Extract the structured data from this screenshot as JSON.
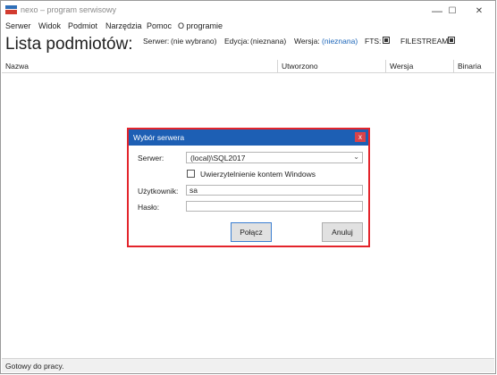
{
  "window": {
    "title": "nexo – program serwisowy",
    "minimize_glyph": "—",
    "maximize_glyph": "☐",
    "close_glyph": "✕"
  },
  "menu": [
    "Serwer",
    "Widok",
    "Podmiot",
    "Narzędzia",
    "Pomoc",
    "O programie"
  ],
  "page": {
    "title": "Lista podmiotów:",
    "server_label": "Serwer:",
    "server_value": "(nie wybrano)",
    "edition_label": "Edycja:",
    "edition_value": "(nieznana)",
    "version_label": "Wersja:",
    "version_value": "(nieznana)",
    "fts_label": "FTS:",
    "filestream_label": "FILESTREAM:"
  },
  "grid": {
    "columns": [
      "Nazwa",
      "Utworzono",
      "Wersja",
      "Binaria"
    ]
  },
  "status_bar": {
    "text": "Gotowy do pracy."
  },
  "dialog": {
    "title": "Wybór serwera",
    "close_glyph": "x",
    "server_label": "Serwer:",
    "server_value": "(local)\\SQL2017",
    "windows_auth_label": "Uwierzytelnienie kontem Windows",
    "user_label": "Użytkownik:",
    "user_value": "sa",
    "password_label": "Hasło:",
    "password_value": "",
    "connect_label": "Połącz",
    "cancel_label": "Anuluj"
  },
  "colors": {
    "dialog_title_bg": "#1d5fb4",
    "dialog_highlight": "#e3242b",
    "link": "#1a64b8"
  },
  "icons": [
    "app-icon",
    "minimize-icon",
    "maximize-icon",
    "close-icon",
    "dropdown-arrow-icon",
    "dialog-close-icon"
  ]
}
